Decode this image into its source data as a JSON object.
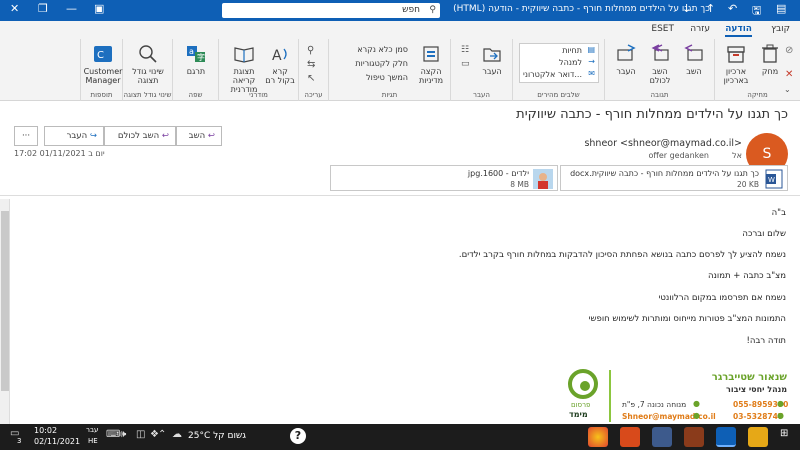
{
  "window": {
    "title": "כך תגנו על הילדים ממחלות חורף - כתבה שיווקית  -  הודעה (HTML)",
    "search_placeholder": "חפש"
  },
  "tabs": [
    "קובץ",
    "הודעה",
    "עזרה",
    "ESET"
  ],
  "ribbon": {
    "groups": {
      "delete": "מחיקה",
      "respond": "תגובה",
      "quick_steps": "שלבים מהירים",
      "move": "העבר",
      "tags": "תגיות",
      "editing": "עריכה",
      "immersive": "מודרני",
      "language": "שפה",
      "zoom": "שינוי גודל תצוגה",
      "addins": "תוספות"
    },
    "buttons": {
      "delete": "מחק",
      "archive": "ארכיון",
      "archive2": "בארכיון",
      "reply": "השב",
      "reply_all": "השב לכולם",
      "forward": "העבר",
      "move": "העבר",
      "policy": "הקצה מדיניות",
      "read_aloud": "קרא בקול רם",
      "immersive_reader": "תצוגת קריאה מודרנית",
      "translate": "תרגם",
      "zoom": "שינוי גודל תצוגה",
      "customer_manager": "Customer Manager"
    },
    "quick_steps": [
      "תחיות",
      "למנהל",
      "דואר אלקטרוני..."
    ],
    "tag_items": [
      "סמן כלא נקרא",
      "חלק לקטגוריות",
      "המשך טיפול"
    ]
  },
  "message": {
    "subject": "כך תגנו על הילדים ממחלות חורף - כתבה שיווקית",
    "reply": "השב",
    "reply_all": "השב לכולם",
    "forward": "העבר",
    "more": "···",
    "avatar_letter": "S",
    "sender": "shneor <shneor@maymad.co.il>",
    "to_label": "אל",
    "to": "offer gedanken",
    "datetime": "יום ב 01/11/2021 17:02",
    "attachments": [
      {
        "name": "כך תגנו על הילדים ממחלות חורף - כתבה שיווקית.docx",
        "size": "20 KB"
      },
      {
        "name": "ילדים - 1600.jpg",
        "size": "8 MB"
      }
    ]
  },
  "body": {
    "lines": [
      "ב\"ה",
      "שלום וברכה",
      "נשמח להציע לך לפרסם כתבה בנושא הפחתת הסיכון להדבקות במחלות חורף בקרב ילדים.",
      "מצ\"ב כתבה + תמונה",
      "נשמח אם תפרסמו במקום הרלוונטי",
      "התמונות המצ\"ב פטורות מייחוס ומותרות לשימוש חופשי",
      "תודה רבה!"
    ]
  },
  "signature": {
    "name": "שנאור שטייברגר",
    "role": "מנהל יחסי ציבור",
    "phone1": "055-8959390",
    "phone2": "03-5328747",
    "address": "מנוחה נכונה 7, פ\"ת",
    "email": "Shneor@maymad.co.il",
    "logo_text1": "פרסום",
    "logo_text2": "מימד"
  },
  "taskbar": {
    "weather": "25°C  גשום קל",
    "lang": "עבר",
    "lang2": "HE",
    "time": "10:02",
    "date": "02/11/2021",
    "badge": "3"
  },
  "colors": {
    "titlebar": "#0e5fb5",
    "accent": "#0e5fb5",
    "avatar": "#da5a20",
    "signature_green": "#6aa32a",
    "signature_orange": "#e07c18"
  }
}
